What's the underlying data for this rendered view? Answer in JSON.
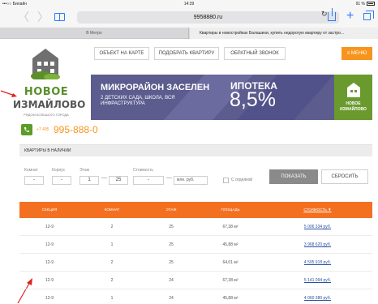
{
  "status_bar": {
    "carrier": "•••○○ Билайн",
    "time": "14:39",
    "battery": "91 %"
  },
  "browser": {
    "url": "9958880.ru",
    "tabs": [
      {
        "label": "В Метро"
      },
      {
        "label": "Квартиры в новостройках Балашихи, купить недорогую квартиру от застро..."
      }
    ]
  },
  "header": {
    "nav": [
      "ОБЪЕКТ НА КАРТЕ",
      "ПОДОБРАТЬ КВАРТИРУ",
      "ОБРАТНЫЙ ЗВОНОК"
    ],
    "menu_label": "≡ МЕНЮ"
  },
  "logo": {
    "line1": "НОВОЕ",
    "line2": "ИЗМАЙЛОВО",
    "tagline": "РЯДОМ БОЛЬШОГО ГОРОДА"
  },
  "banner": {
    "headline": "МИКРОРАЙОН ЗАСЕЛЕН",
    "subline": "2 ДЕТСКИХ САДА, ШКОЛА, ВСЯ ИНФРАСТРУКТУРА",
    "mortgage_label": "ИПОТЕКА",
    "mortgage_rate": "8,5%",
    "badge_line1": "НОВОЕ",
    "badge_line2": "ИЗМАЙЛОВО"
  },
  "phone": {
    "prefix": "+7 495",
    "number": "995-888-0"
  },
  "section_title": "КВАРТИРЫ В НАЛИЧИИ",
  "filters": {
    "labels": {
      "rooms": "Комнат",
      "building": "Корпус",
      "floor": "Этаж",
      "price": "Стоимость"
    },
    "rooms_value": "-",
    "building_value": "-",
    "floor_from": "1",
    "floor_to": "25",
    "price_from": "-",
    "price_to_placeholder": "",
    "price_unit": "млн. руб.",
    "finishing_label": "С отделкой",
    "show_button": "ПОКАЗАТЬ",
    "reset_button": "СБРОСИТЬ"
  },
  "table": {
    "headers": [
      "СЕКЦИЯ",
      "КОМНАТ",
      "ЭТАЖ",
      "ПЛОЩАДЬ",
      "СТОИМОСТЬ ▼"
    ],
    "rows": [
      [
        "12-9",
        "2",
        "25",
        "67,38 м²",
        "5 006 334 руб."
      ],
      [
        "12-9",
        "1",
        "25",
        "45,88 м²",
        "3 968 620 руб."
      ],
      [
        "12-9",
        "2",
        "25",
        "64,01 м²",
        "4 595 918 руб."
      ],
      [
        "12-9",
        "2",
        "24",
        "67,38 м²",
        "5 141 094 руб."
      ],
      [
        "12-9",
        "1",
        "24",
        "45,88 м²",
        "4 060 380 руб."
      ]
    ]
  },
  "colors": {
    "accent": "#f7941d",
    "table_header": "#f37021",
    "brand_green": "#5a8f2a",
    "banner": "#5c5c8f"
  }
}
